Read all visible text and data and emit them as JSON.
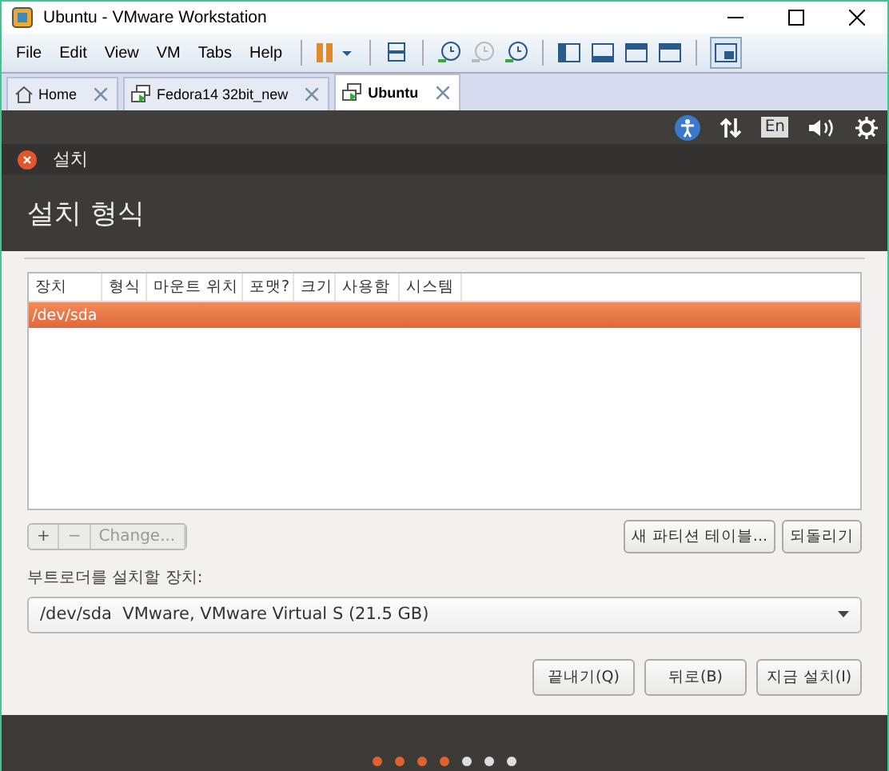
{
  "window": {
    "title": "Ubuntu - VMware Workstation"
  },
  "menu": [
    "File",
    "Edit",
    "View",
    "VM",
    "Tabs",
    "Help"
  ],
  "toolbar": [
    {
      "kind": "pause",
      "disabled": false
    },
    {
      "kind": "send-keys",
      "disabled": false
    },
    {
      "kind": "snapshot",
      "disabled": false
    },
    {
      "kind": "revert",
      "disabled": true
    },
    {
      "kind": "manager",
      "disabled": false
    },
    {
      "kind": "sidebar",
      "disabled": false
    },
    {
      "kind": "console",
      "disabled": false
    },
    {
      "kind": "fullscreen",
      "disabled": false
    },
    {
      "kind": "unity",
      "disabled": false
    },
    {
      "kind": "view",
      "disabled": false
    }
  ],
  "tabs": [
    {
      "label": "Home",
      "kind": "home",
      "selected": false
    },
    {
      "label": "Fedora14 32bit_new",
      "kind": "vm",
      "selected": false
    },
    {
      "label": "Ubuntu",
      "kind": "vm",
      "selected": true
    }
  ],
  "panel": {
    "keyboard": "En"
  },
  "dialog": {
    "title": "설치",
    "heading": "설치 형식"
  },
  "table": {
    "columns": [
      "장치",
      "형식",
      "마운트 위치",
      "포맷?",
      "크기",
      "사용함",
      "시스템"
    ],
    "rows": [
      {
        "cells": [
          "/dev/sda"
        ],
        "selected": true
      }
    ]
  },
  "partition_buttons": [
    {
      "label": "+",
      "disabled": false
    },
    {
      "label": "−",
      "disabled": true
    },
    {
      "label": "Change...",
      "disabled": true
    }
  ],
  "table_buttons": [
    "새 파티션 테이블...",
    "되돌리기"
  ],
  "bootloader": {
    "label": "부트로더를 설치할 장치:",
    "value": "/dev/sda  VMware, VMware Virtual S (21.5 GB)"
  },
  "actions": [
    "끝내기(Q)",
    "뒤로(B)",
    "지금 설치(I)"
  ],
  "steps": [
    {
      "done": true
    },
    {
      "done": true
    },
    {
      "done": true
    },
    {
      "done": true
    },
    {
      "done": false
    },
    {
      "done": false
    },
    {
      "done": false
    }
  ]
}
